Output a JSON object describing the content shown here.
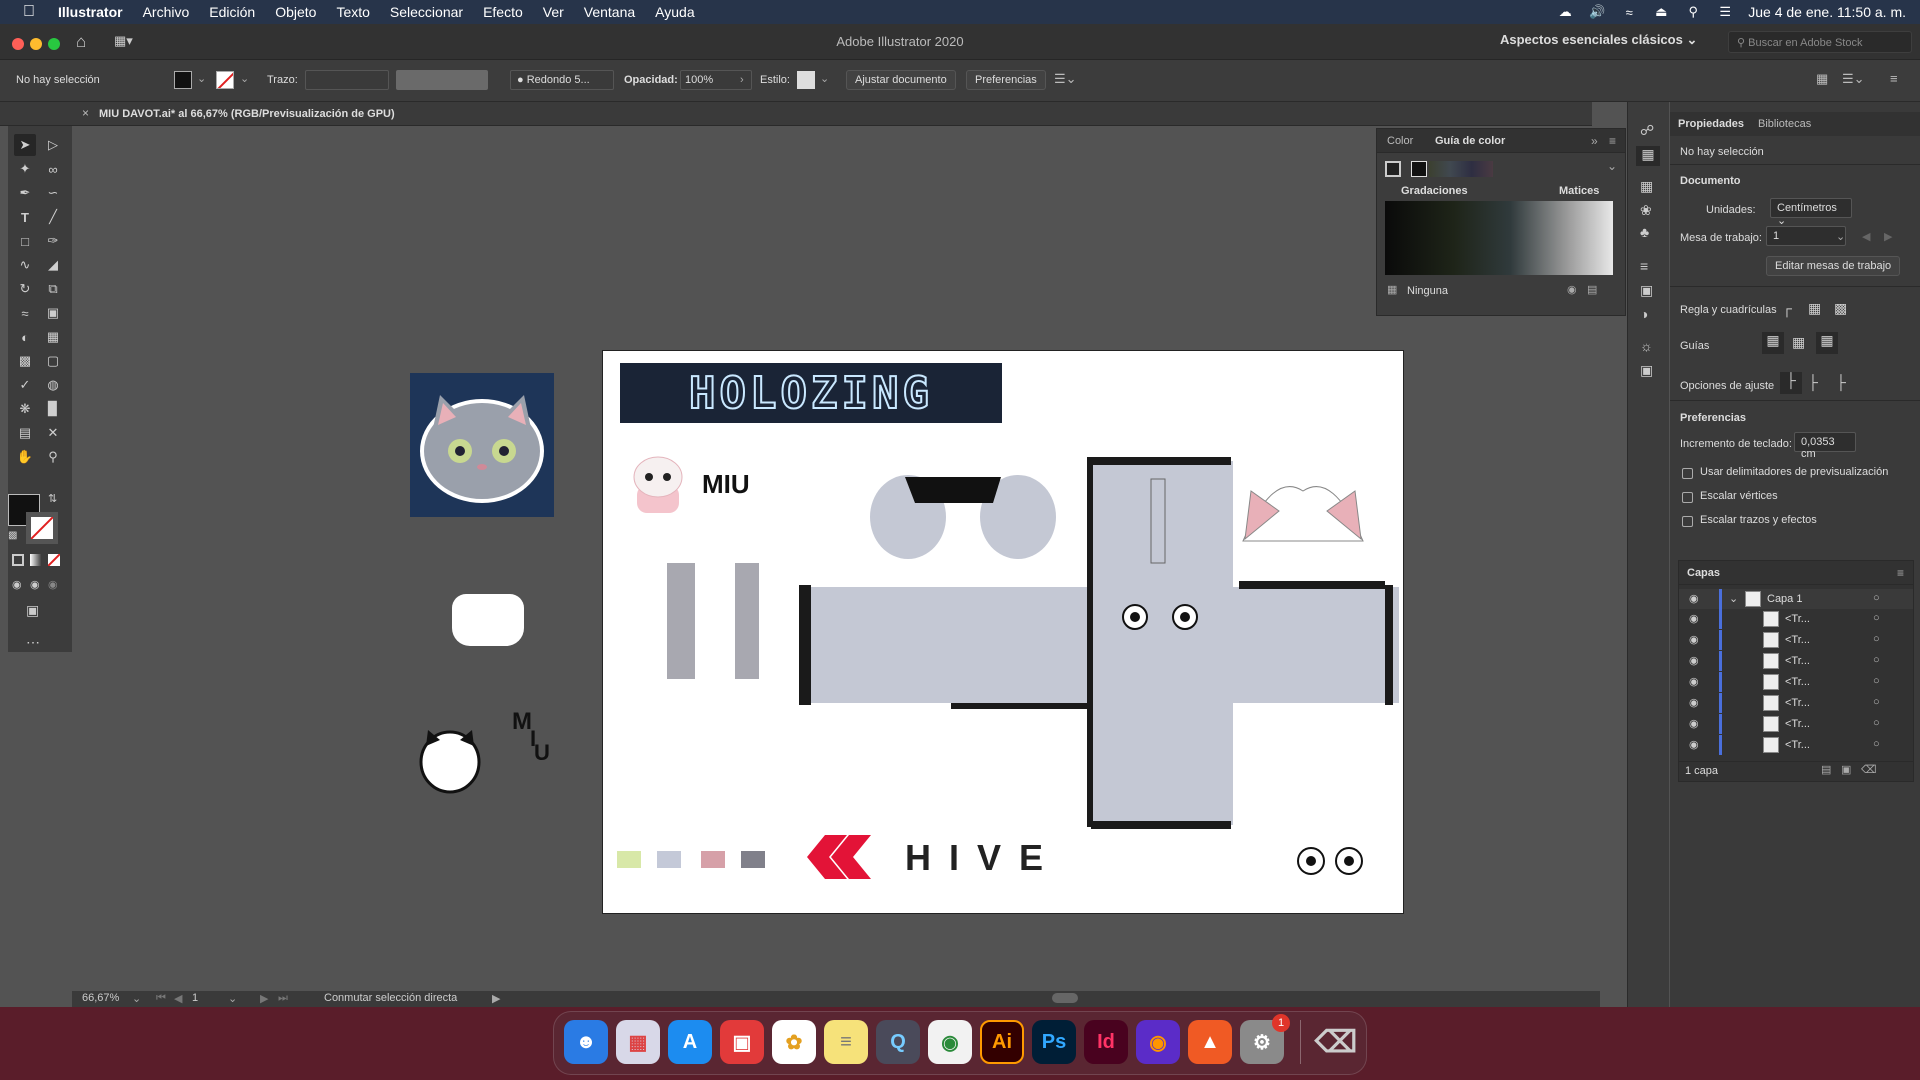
{
  "menubar": {
    "app": "Illustrator",
    "items": [
      "Archivo",
      "Edición",
      "Objeto",
      "Texto",
      "Seleccionar",
      "Efecto",
      "Ver",
      "Ventana",
      "Ayuda"
    ],
    "clock": "Jue 4 de ene.  11:50 a. m."
  },
  "window": {
    "title": "Adobe Illustrator 2020",
    "workspace": "Aspectos esenciales clásicos",
    "stock_placeholder": "Buscar en Adobe Stock"
  },
  "control": {
    "selection": "No hay selección",
    "stroke_label": "Trazo:",
    "brush": "Redondo 5...",
    "opacity_label": "Opacidad:",
    "opacity": "100%",
    "style_label": "Estilo:",
    "fit_doc": "Ajustar documento",
    "prefs": "Preferencias"
  },
  "doc_tab": "MIU DAVOT.ai* al 66,67% (RGB/Previsualización de GPU)",
  "status": {
    "zoom": "66,67%",
    "artboard": "1",
    "tool": "Conmutar selección directa"
  },
  "color_panel": {
    "tab_color": "Color",
    "tab_guide": "Guía de color",
    "gradations": "Gradaciones",
    "hues": "Matices",
    "none": "Ninguna"
  },
  "properties": {
    "tab_props": "Propiedades",
    "tab_libs": "Bibliotecas",
    "no_selection": "No hay selección",
    "document": "Documento",
    "units_label": "Unidades:",
    "units": "Centímetros",
    "artboard_label": "Mesa de trabajo:",
    "artboard": "1",
    "edit_artboards": "Editar mesas de trabajo",
    "rulers": "Regla y cuadrículas",
    "guides": "Guías",
    "snap": "Opciones de ajuste",
    "preferences": "Preferencias",
    "key_inc_label": "Incremento de teclado:",
    "key_inc": "0,0353 cm",
    "cb1": "Usar delimitadores de previsualización",
    "cb2": "Escalar vértices",
    "cb3": "Escalar trazos y efectos"
  },
  "layers": {
    "title": "Capas",
    "layer1": "Capa 1",
    "sublayers": [
      "<Tr...",
      "<Tr...",
      "<Tr...",
      "<Tr...",
      "<Tr...",
      "<Tr...",
      "<Tr..."
    ],
    "count": "1 capa"
  },
  "art": {
    "logo_text": "HOLOZING",
    "miu": "MIU",
    "hive": "HIVE",
    "side_m": "M",
    "side_i": "I",
    "side_u": "U"
  },
  "palette": [
    "#d8e8a8",
    "#c4c9d8",
    "#d6a0a8",
    "#80808a"
  ],
  "dock": {
    "ai": "Ai",
    "ps": "Ps",
    "id": "Id",
    "badge": "1"
  }
}
